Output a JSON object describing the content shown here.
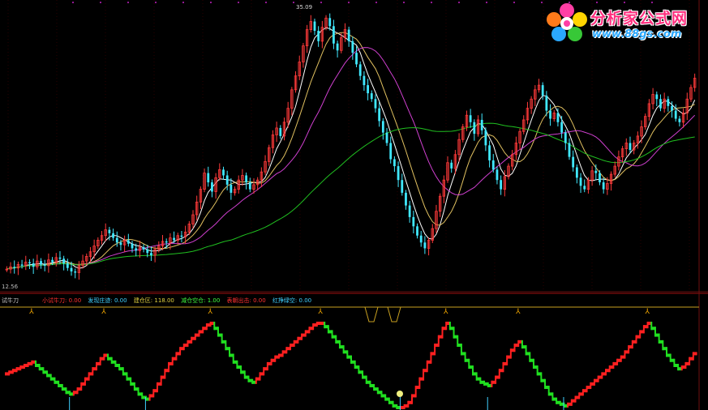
{
  "chart_data": [
    {
      "type": "candlestick",
      "price_labels": {
        "high": "35.09",
        "low": "12.56"
      },
      "series": [
        {
          "name": "",
          "color": "#ffffff"
        },
        {
          "name": "",
          "color": "#e0c060"
        },
        {
          "name": "",
          "color": "#d040d0"
        },
        {
          "name": "",
          "color": "#20c020"
        }
      ],
      "closes": [
        12.9,
        13.1,
        13.0,
        13.3,
        13.2,
        13.5,
        13.4,
        13.1,
        13.6,
        13.3,
        13.2,
        13.7,
        13.5,
        13.9,
        13.8,
        13.4,
        13.0,
        12.7,
        12.6,
        13.2,
        13.6,
        14.0,
        14.4,
        14.9,
        15.4,
        15.8,
        16.3,
        16.0,
        15.6,
        15.2,
        15.0,
        15.4,
        15.1,
        14.7,
        14.5,
        14.8,
        14.6,
        14.3,
        14.1,
        14.6,
        14.9,
        15.3,
        15.2,
        15.6,
        15.4,
        15.8,
        15.7,
        16.1,
        16.8,
        17.6,
        18.7,
        19.8,
        21.2,
        20.4,
        19.6,
        20.8,
        21.5,
        21.0,
        20.2,
        19.5,
        19.8,
        20.6,
        21.0,
        20.4,
        19.8,
        20.2,
        20.6,
        21.3,
        22.2,
        23.4,
        24.5,
        25.1,
        24.4,
        25.6,
        26.8,
        28.4,
        29.6,
        30.8,
        32.2,
        33.6,
        34.3,
        33.5,
        32.6,
        33.8,
        34.6,
        33.9,
        32.4,
        31.8,
        32.9,
        33.6,
        32.6,
        31.6,
        30.6,
        29.6,
        28.8,
        28.1,
        27.6,
        26.8,
        25.7,
        24.7,
        23.8,
        22.4,
        21.8,
        20.6,
        19.5,
        18.4,
        17.4,
        16.6,
        15.8,
        15.2,
        14.7,
        15.4,
        16.4,
        17.9,
        19.2,
        20.6,
        22.1,
        21.6,
        22.8,
        24.1,
        25.2,
        26.2,
        25.6,
        24.6,
        25.8,
        24.9,
        23.6,
        22.3,
        21.5,
        20.6,
        19.8,
        20.9,
        21.8,
        22.8,
        23.8,
        24.8,
        25.8,
        26.8,
        27.6,
        28.4,
        28.8,
        27.9,
        26.6,
        25.9,
        26.4,
        25.6,
        24.7,
        23.8,
        22.6,
        21.7,
        20.8,
        20.1,
        19.8,
        20.6,
        21.4,
        21.2,
        20.4,
        19.8,
        20.3,
        21.1,
        21.8,
        22.6,
        23.3,
        23.8,
        23.2,
        23.8,
        24.4,
        25.2,
        26.1,
        27.2,
        28.0,
        27.6,
        26.8,
        27.6,
        27.0,
        26.6,
        25.9,
        25.6,
        26.4,
        27.6,
        28.6,
        29.4
      ],
      "oscillator": {
        "type": "step_line",
        "rising_color": "#ff2020",
        "falling_color": "#20e020",
        "values": [
          40,
          42,
          44,
          46,
          48,
          50,
          52,
          54,
          50,
          46,
          42,
          38,
          34,
          30,
          26,
          22,
          18,
          16,
          18,
          22,
          28,
          34,
          40,
          46,
          52,
          58,
          62,
          58,
          54,
          50,
          46,
          40,
          34,
          28,
          22,
          16,
          12,
          10,
          14,
          20,
          28,
          36,
          44,
          52,
          58,
          64,
          70,
          74,
          78,
          82,
          86,
          90,
          94,
          98,
          100,
          94,
          86,
          78,
          70,
          62,
          54,
          48,
          42,
          36,
          32,
          30,
          34,
          40,
          46,
          52,
          56,
          60,
          62,
          66,
          70,
          74,
          78,
          82,
          86,
          90,
          94,
          98,
          100,
          100,
          96,
          90,
          84,
          78,
          72,
          66,
          60,
          54,
          48,
          42,
          36,
          30,
          26,
          22,
          18,
          14,
          10,
          6,
          2,
          0,
          0,
          2,
          6,
          14,
          24,
          34,
          44,
          54,
          64,
          74,
          84,
          94,
          100,
          94,
          84,
          74,
          64,
          56,
          48,
          40,
          34,
          30,
          28,
          26,
          30,
          36,
          44,
          52,
          60,
          68,
          74,
          78,
          72,
          64,
          56,
          48,
          40,
          32,
          24,
          16,
          10,
          6,
          4,
          2,
          4,
          8,
          12,
          16,
          20,
          24,
          28,
          32,
          36,
          40,
          44,
          48,
          52,
          56,
          60,
          66,
          72,
          78,
          84,
          90,
          96,
          100,
          94,
          86,
          78,
          70,
          62,
          56,
          50,
          46,
          48,
          52,
          58,
          64,
          70,
          76,
          82,
          88,
          92,
          94
        ]
      },
      "indicator_title": "试牛刀",
      "indicator_legend": [
        {
          "label": "小试牛刀: 0.00",
          "color": "#ff3030"
        },
        {
          "label": "发现庄迹: 0.00",
          "color": "#40d0ff"
        },
        {
          "label": "建仓区: 118.00",
          "color": "#e0d040"
        },
        {
          "label": "减仓空仓: 1.00",
          "color": "#40ff40"
        },
        {
          "label": "表朝出击: 0.00",
          "color": "#ff3030"
        },
        {
          "label": "红挣绿空: 0.00",
          "color": "#40d0ff"
        }
      ]
    }
  ],
  "logo": {
    "name": "分析家公式网",
    "url": "www.88gs.com"
  }
}
